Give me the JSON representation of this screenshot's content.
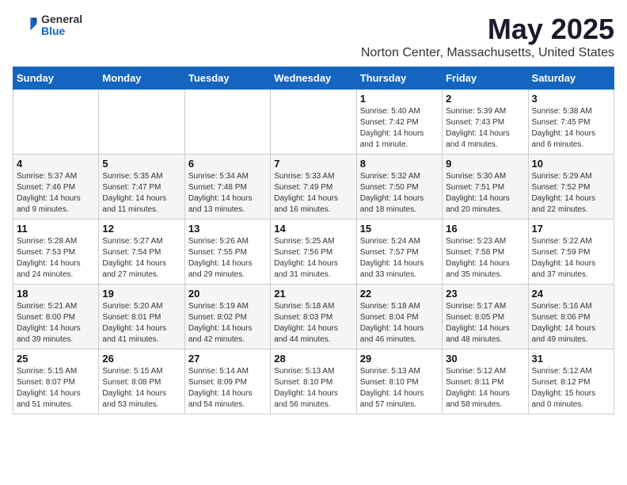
{
  "header": {
    "logo_general": "General",
    "logo_blue": "Blue",
    "title": "May 2025",
    "subtitle": "Norton Center, Massachusetts, United States"
  },
  "days_of_week": [
    "Sunday",
    "Monday",
    "Tuesday",
    "Wednesday",
    "Thursday",
    "Friday",
    "Saturday"
  ],
  "weeks": [
    [
      {
        "day": "",
        "info": ""
      },
      {
        "day": "",
        "info": ""
      },
      {
        "day": "",
        "info": ""
      },
      {
        "day": "",
        "info": ""
      },
      {
        "day": "1",
        "info": "Sunrise: 5:40 AM\nSunset: 7:42 PM\nDaylight: 14 hours\nand 1 minute."
      },
      {
        "day": "2",
        "info": "Sunrise: 5:39 AM\nSunset: 7:43 PM\nDaylight: 14 hours\nand 4 minutes."
      },
      {
        "day": "3",
        "info": "Sunrise: 5:38 AM\nSunset: 7:45 PM\nDaylight: 14 hours\nand 6 minutes."
      }
    ],
    [
      {
        "day": "4",
        "info": "Sunrise: 5:37 AM\nSunset: 7:46 PM\nDaylight: 14 hours\nand 9 minutes."
      },
      {
        "day": "5",
        "info": "Sunrise: 5:35 AM\nSunset: 7:47 PM\nDaylight: 14 hours\nand 11 minutes."
      },
      {
        "day": "6",
        "info": "Sunrise: 5:34 AM\nSunset: 7:48 PM\nDaylight: 14 hours\nand 13 minutes."
      },
      {
        "day": "7",
        "info": "Sunrise: 5:33 AM\nSunset: 7:49 PM\nDaylight: 14 hours\nand 16 minutes."
      },
      {
        "day": "8",
        "info": "Sunrise: 5:32 AM\nSunset: 7:50 PM\nDaylight: 14 hours\nand 18 minutes."
      },
      {
        "day": "9",
        "info": "Sunrise: 5:30 AM\nSunset: 7:51 PM\nDaylight: 14 hours\nand 20 minutes."
      },
      {
        "day": "10",
        "info": "Sunrise: 5:29 AM\nSunset: 7:52 PM\nDaylight: 14 hours\nand 22 minutes."
      }
    ],
    [
      {
        "day": "11",
        "info": "Sunrise: 5:28 AM\nSunset: 7:53 PM\nDaylight: 14 hours\nand 24 minutes."
      },
      {
        "day": "12",
        "info": "Sunrise: 5:27 AM\nSunset: 7:54 PM\nDaylight: 14 hours\nand 27 minutes."
      },
      {
        "day": "13",
        "info": "Sunrise: 5:26 AM\nSunset: 7:55 PM\nDaylight: 14 hours\nand 29 minutes."
      },
      {
        "day": "14",
        "info": "Sunrise: 5:25 AM\nSunset: 7:56 PM\nDaylight: 14 hours\nand 31 minutes."
      },
      {
        "day": "15",
        "info": "Sunrise: 5:24 AM\nSunset: 7:57 PM\nDaylight: 14 hours\nand 33 minutes."
      },
      {
        "day": "16",
        "info": "Sunrise: 5:23 AM\nSunset: 7:58 PM\nDaylight: 14 hours\nand 35 minutes."
      },
      {
        "day": "17",
        "info": "Sunrise: 5:22 AM\nSunset: 7:59 PM\nDaylight: 14 hours\nand 37 minutes."
      }
    ],
    [
      {
        "day": "18",
        "info": "Sunrise: 5:21 AM\nSunset: 8:00 PM\nDaylight: 14 hours\nand 39 minutes."
      },
      {
        "day": "19",
        "info": "Sunrise: 5:20 AM\nSunset: 8:01 PM\nDaylight: 14 hours\nand 41 minutes."
      },
      {
        "day": "20",
        "info": "Sunrise: 5:19 AM\nSunset: 8:02 PM\nDaylight: 14 hours\nand 42 minutes."
      },
      {
        "day": "21",
        "info": "Sunrise: 5:18 AM\nSunset: 8:03 PM\nDaylight: 14 hours\nand 44 minutes."
      },
      {
        "day": "22",
        "info": "Sunrise: 5:18 AM\nSunset: 8:04 PM\nDaylight: 14 hours\nand 46 minutes."
      },
      {
        "day": "23",
        "info": "Sunrise: 5:17 AM\nSunset: 8:05 PM\nDaylight: 14 hours\nand 48 minutes."
      },
      {
        "day": "24",
        "info": "Sunrise: 5:16 AM\nSunset: 8:06 PM\nDaylight: 14 hours\nand 49 minutes."
      }
    ],
    [
      {
        "day": "25",
        "info": "Sunrise: 5:15 AM\nSunset: 8:07 PM\nDaylight: 14 hours\nand 51 minutes."
      },
      {
        "day": "26",
        "info": "Sunrise: 5:15 AM\nSunset: 8:08 PM\nDaylight: 14 hours\nand 53 minutes."
      },
      {
        "day": "27",
        "info": "Sunrise: 5:14 AM\nSunset: 8:09 PM\nDaylight: 14 hours\nand 54 minutes."
      },
      {
        "day": "28",
        "info": "Sunrise: 5:13 AM\nSunset: 8:10 PM\nDaylight: 14 hours\nand 56 minutes."
      },
      {
        "day": "29",
        "info": "Sunrise: 5:13 AM\nSunset: 8:10 PM\nDaylight: 14 hours\nand 57 minutes."
      },
      {
        "day": "30",
        "info": "Sunrise: 5:12 AM\nSunset: 8:11 PM\nDaylight: 14 hours\nand 58 minutes."
      },
      {
        "day": "31",
        "info": "Sunrise: 5:12 AM\nSunset: 8:12 PM\nDaylight: 15 hours\nand 0 minutes."
      }
    ]
  ]
}
